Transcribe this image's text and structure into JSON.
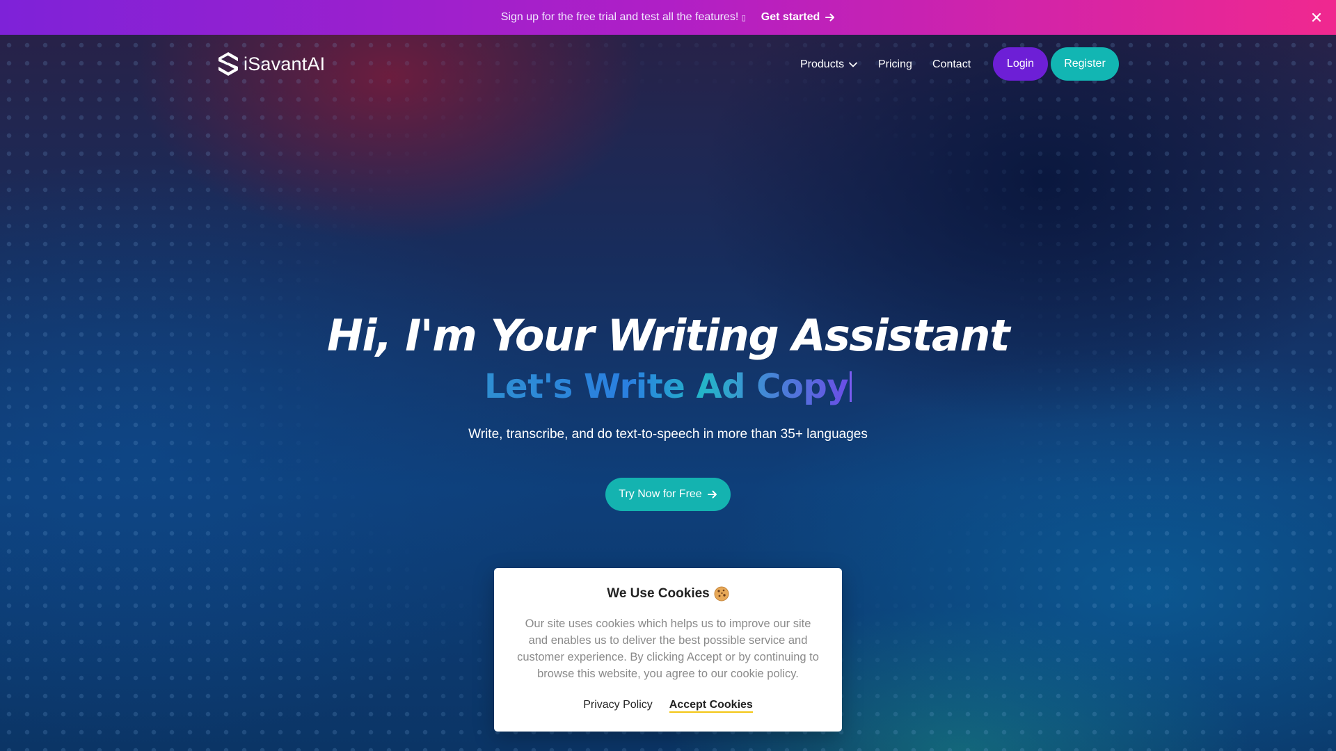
{
  "promo": {
    "text": "Sign up for the free trial and test all the features! ",
    "emoji_placeholder": "▯",
    "link_label": "Get started"
  },
  "header": {
    "brand": "iSavantAI",
    "nav": {
      "products": "Products",
      "pricing": "Pricing",
      "contact": "Contact"
    },
    "login_label": "Login",
    "register_label": "Register"
  },
  "hero": {
    "title": "Hi, I'm Your Writing Assistant",
    "typed_line": "Let's Write Ad Copy",
    "description": "Write, transcribe, and do text-to-speech in more than 35+ languages",
    "cta_label": "Try Now for Free"
  },
  "cookie_notice": {
    "title": "We Use Cookies",
    "body": "Our site uses cookies which helps us to improve our site and enables us to deliver the best possible service and customer experience. By clicking Accept or by continuing to browse this website, you agree to our cookie policy.",
    "privacy_label": "Privacy Policy",
    "accept_label": "Accept Cookies"
  },
  "colors": {
    "promo_start": "#7e22d8",
    "promo_end": "#f0288f",
    "login_bg": "#6d1fd6",
    "register_bg": "#12b6b3",
    "cta_bg": "#14b3b0",
    "accept_underline": "#f3c614"
  },
  "icons": {
    "promo_arrow": "arrow-right-icon",
    "promo_close": "close-icon",
    "logo": "savant-logo-icon",
    "products_caret": "chevron-down-icon",
    "cta_arrow": "arrow-right-icon",
    "cookie": "cookie-icon"
  }
}
